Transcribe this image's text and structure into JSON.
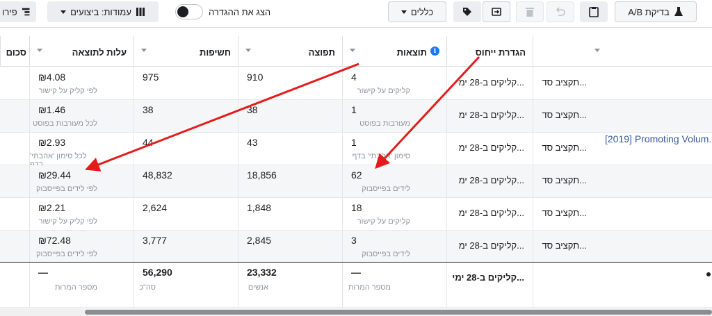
{
  "toolbar": {
    "breakdown_label": "פירו",
    "columns_label": "עמודות: ביצועים",
    "show_setting_label": "הצג את ההגדרה",
    "rules_label": "כללים",
    "ab_test_label": "בדיקת A/B"
  },
  "columns": {
    "col_sum": "סכום",
    "cost_per_result": "עלות לתוצאה",
    "impressions": "חשיפות",
    "reach": "תפוצה",
    "results": "תוצאות",
    "attribution": "הגדרת ייחוס"
  },
  "campaign_name": "[2019] Promoting Volum...",
  "rows": [
    {
      "cost": "₪4.08",
      "cost_sub": "לפי קליק על קישור",
      "impressions": "975",
      "reach": "910",
      "results": "4",
      "results_sub": "קליקים על קישור",
      "attribution": "קליקים ב-28 ימ...",
      "budget": "תקציב סד..."
    },
    {
      "cost": "₪1.46",
      "cost_sub": "לכל מעורבות בפוסט",
      "impressions": "38",
      "reach": "38",
      "results": "1",
      "results_sub": "מעורבות בפוסט",
      "attribution": "קליקים ב-28 ימ...",
      "budget": "תקציב סד..."
    },
    {
      "cost": "₪2.93",
      "cost_sub": "לכל סימון 'אהבתי' בדף",
      "impressions": "44",
      "reach": "43",
      "results": "1",
      "results_sub": "סימון 'אהבתי' בדף",
      "attribution": "קליקים ב-28 ימ...",
      "budget": "תקציב סד..."
    },
    {
      "cost": "₪29.44",
      "cost_sub": "לפי לידים בפייסבוק",
      "impressions": "48,832",
      "reach": "18,856",
      "results": "62",
      "results_sub": "לידים בפייסבוק",
      "attribution": "קליקים ב-28 ימ...",
      "budget": "תקציב סד..."
    },
    {
      "cost": "₪2.21",
      "cost_sub": "לפי קליק על קישור",
      "impressions": "2,624",
      "reach": "1,848",
      "results": "18",
      "results_sub": "קליקים על קישור",
      "attribution": "קליקים ב-28 ימ...",
      "budget": "תקציב סד..."
    },
    {
      "cost": "₪72.48",
      "cost_sub": "לפי לידים בפייסבוק",
      "impressions": "3,777",
      "reach": "2,845",
      "results": "3",
      "results_sub": "לידים בפייסבוק",
      "attribution": "קליקים ב-28 ימ...",
      "budget": "תקציב סד..."
    }
  ],
  "totals": {
    "cost": "—",
    "cost_sub": "מספר המרות",
    "impressions": "56,290",
    "impressions_sub": "סה\"כ",
    "reach": "23,332",
    "reach_sub": "אנשים",
    "results": "—",
    "results_sub": "מספר המרות",
    "attribution": "קליקים ב-28 ימי..."
  },
  "colors": {
    "annotation_arrow": "#e31b1b",
    "info_icon": "#1877f2",
    "link": "#385898"
  }
}
